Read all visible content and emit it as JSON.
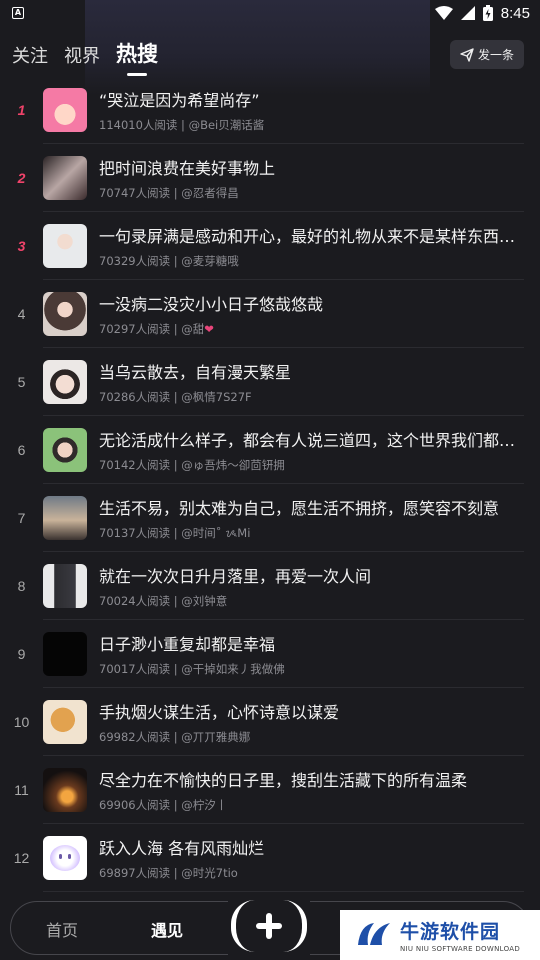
{
  "status_bar": {
    "time": "8:45"
  },
  "tabs": [
    {
      "label": "关注",
      "active": false
    },
    {
      "label": "视界",
      "active": false
    },
    {
      "label": "热搜",
      "active": true
    }
  ],
  "post_button": {
    "label": "发一条",
    "icon": "send-icon"
  },
  "items": [
    {
      "rank": "1",
      "title": "“哭泣是因为希望尚存”",
      "meta": "114010人阅读 | @Bei贝潮话酱"
    },
    {
      "rank": "2",
      "title": "把时间浪费在美好事物上",
      "meta": "70747人阅读 | @忍者得昌"
    },
    {
      "rank": "3",
      "title": "一句录屏满是感动和开心，最好的礼物从来不是某样东西，…",
      "meta": "70329人阅读 | @麦芽糖哦"
    },
    {
      "rank": "4",
      "title": "一没病二没灾小小日子悠哉悠哉",
      "meta": "70297人阅读 | @甜",
      "heart": "❤"
    },
    {
      "rank": "5",
      "title": "当乌云散去，自有漫天繁星",
      "meta": "70286人阅读 | @枫情7S27F"
    },
    {
      "rank": "6",
      "title": "无论活成什么样子，都会有人说三道四，这个世界我们都只…",
      "meta": "70142人阅读 | @ゅ吾炜～卻茴钘拥"
    },
    {
      "rank": "7",
      "title": "生活不易，别太难为自己，愿生活不拥挤，愿笑容不刻意",
      "meta": "70137人阅读 | @时间˚ ᝰMi"
    },
    {
      "rank": "8",
      "title": "就在一次次日升月落里，再爱一次人间",
      "meta": "70024人阅读 | @刘钟意"
    },
    {
      "rank": "9",
      "title": "日子渺小重复却都是幸福",
      "meta": "70017人阅读 | @干掉如来丿我做佛"
    },
    {
      "rank": "10",
      "title": "手执烟火谋生活，心怀诗意以谋爱",
      "meta": "69982人阅读 | @丌丌雅典娜"
    },
    {
      "rank": "11",
      "title": "尽全力在不愉快的日子里，搜刮生活藏下的所有温柔",
      "meta": "69906人阅读 | @柠汐丨"
    },
    {
      "rank": "12",
      "title": "跃入人海 各有风雨灿烂",
      "meta": "69897人阅读 | @时光7tio"
    }
  ],
  "bottom_nav": [
    {
      "label": "首页",
      "active": false
    },
    {
      "label": "遇见",
      "active": true
    }
  ],
  "watermark": {
    "cn": "牛游软件园",
    "en": "NIU NIU SOFTWARE DOWNLOAD"
  },
  "colors": {
    "background": "#1b1b1f",
    "hot_rank": "#f0436a",
    "watermark_blue": "#1e4fa8"
  }
}
